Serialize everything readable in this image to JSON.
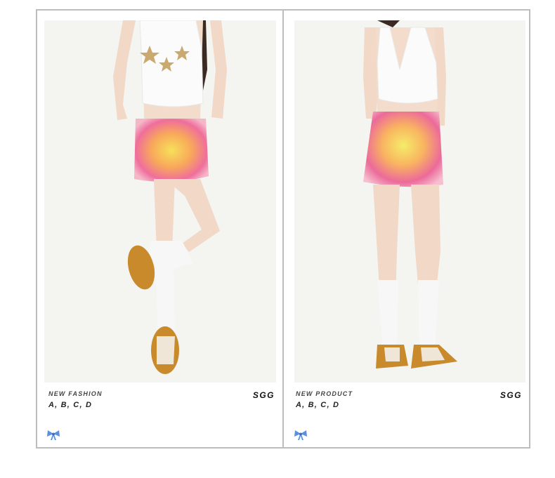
{
  "cards": [
    {
      "caption_title": "NEW FASHION",
      "caption_variants": "A, B, C, D",
      "brand": "SGG"
    },
    {
      "caption_title": "NEW PRODUCT",
      "caption_variants": "A, B, C, D",
      "brand": "SGG"
    }
  ],
  "colors": {
    "border": "#bdbdbd",
    "photo_bg": "#f4f4f1",
    "bow": "#5b8fe0"
  },
  "icons": [
    "bow-icon"
  ]
}
